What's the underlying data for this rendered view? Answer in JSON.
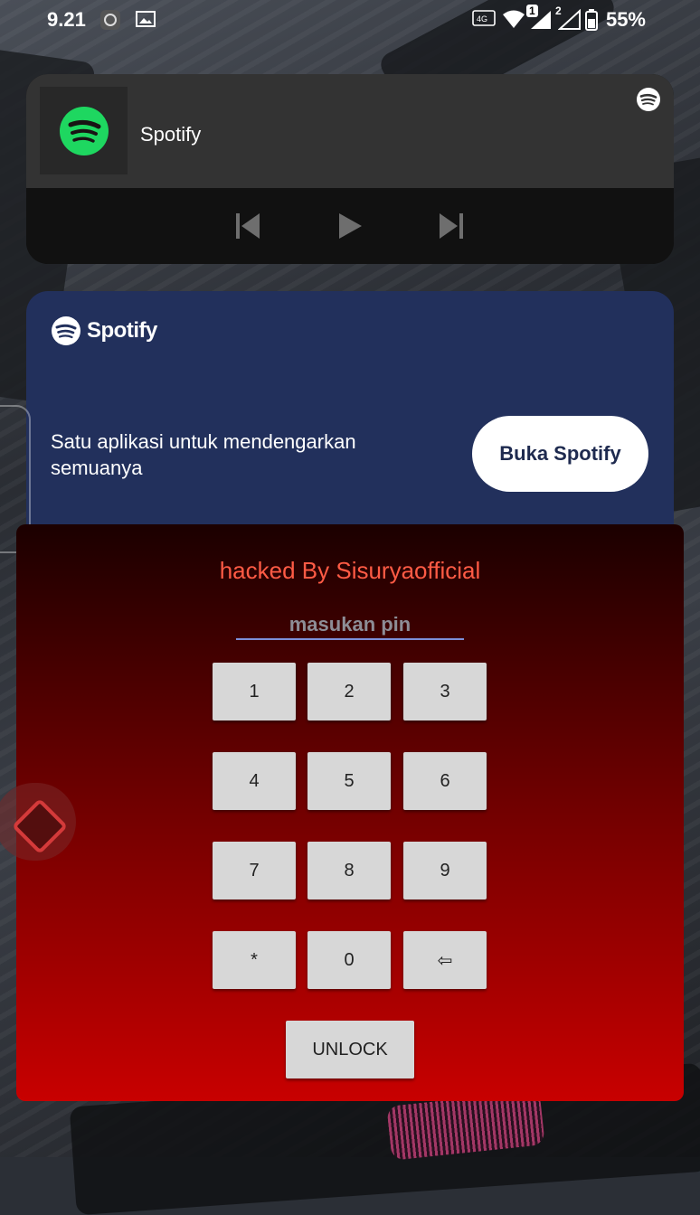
{
  "status_bar": {
    "time": "9.21",
    "battery_percent": "55%",
    "sim1_badge": "1",
    "sim2_badge": "2"
  },
  "media_notification": {
    "app_name": "Spotify",
    "controls": [
      "previous",
      "play",
      "next"
    ]
  },
  "spotify_banner": {
    "logo_text": "Spotify",
    "description": "Satu aplikasi untuk mendengarkan semuanya",
    "button_label": "Buka Spotify"
  },
  "lock_screen": {
    "title": "hacked By Sisuryaofficial",
    "pin_placeholder": "masukan pin",
    "pin_value": "",
    "keys": [
      "1",
      "2",
      "3",
      "4",
      "5",
      "6",
      "7",
      "8",
      "9",
      "*",
      "0",
      "⇦"
    ],
    "unlock_label": "UNLOCK"
  },
  "colors": {
    "spotify_green": "#1ed760",
    "banner_bg": "#22305c",
    "lock_title": "#ff5b45",
    "lock_gradient_top": "#1b0000",
    "lock_gradient_bottom": "#c80000",
    "key_bg": "#d7d7d7"
  }
}
